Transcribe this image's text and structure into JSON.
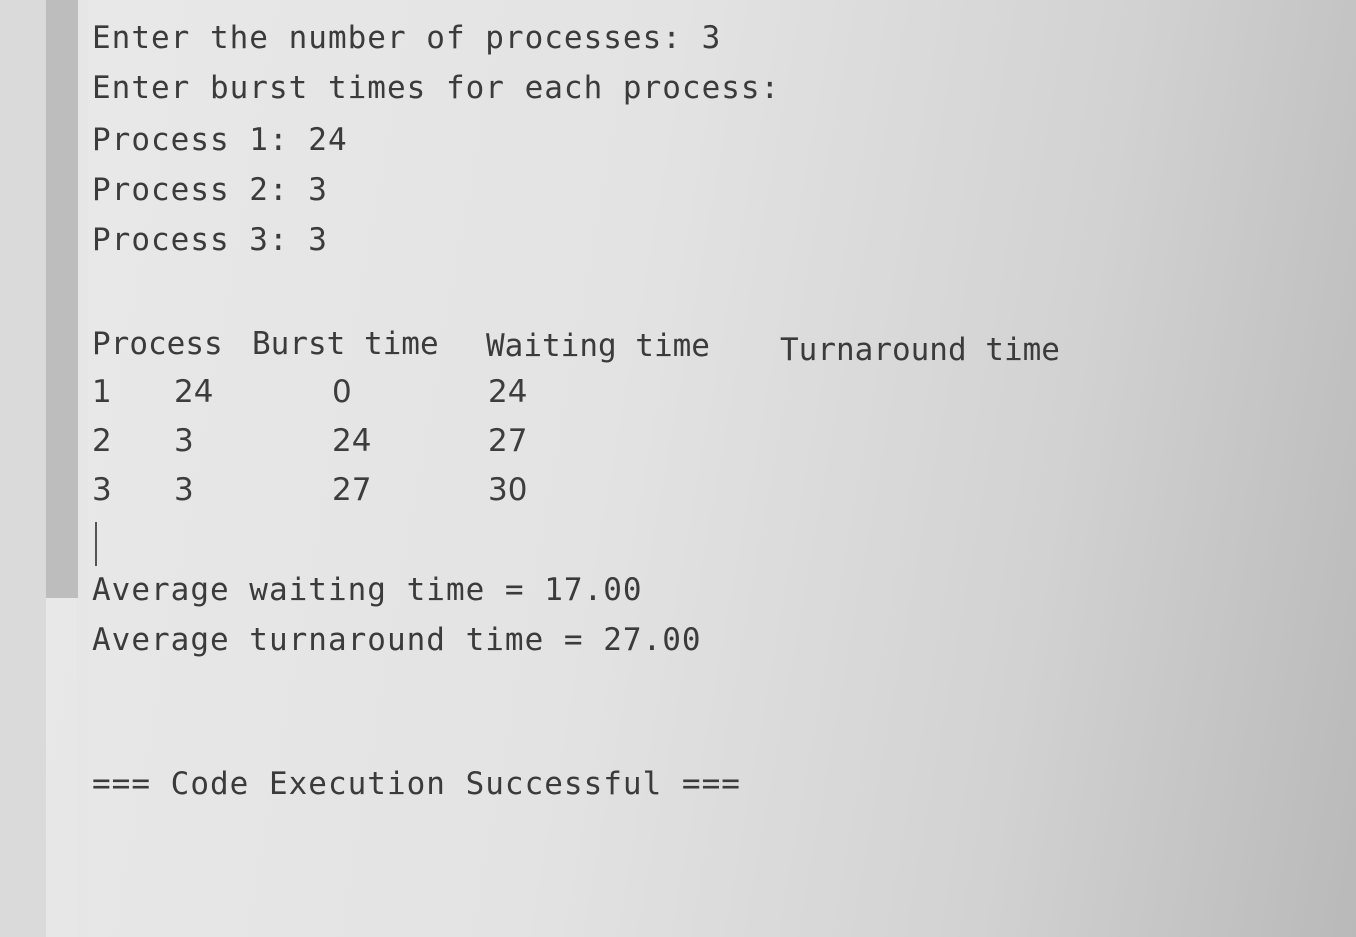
{
  "console": {
    "prompt_count": "Enter the number of processes: 3",
    "prompt_burst": "Enter burst times for each process:",
    "process_inputs": [
      "Process 1: 24",
      "Process 2: 3",
      "Process 3: 3"
    ],
    "table": {
      "headers": {
        "process": "Process",
        "burst": "Burst time",
        "waiting": "Waiting time",
        "turnaround": "Turnaround time"
      },
      "rows": [
        {
          "process": "1",
          "burst": "24",
          "waiting": "0",
          "turnaround": "24"
        },
        {
          "process": "2",
          "burst": "3",
          "waiting": "24",
          "turnaround": "27"
        },
        {
          "process": "3",
          "burst": "3",
          "waiting": "27",
          "turnaround": "30"
        }
      ]
    },
    "avg_waiting": "Average waiting time = 17.00",
    "avg_turnaround": "Average turnaround time = 27.00",
    "status": "=== Code Execution Successful ==="
  }
}
